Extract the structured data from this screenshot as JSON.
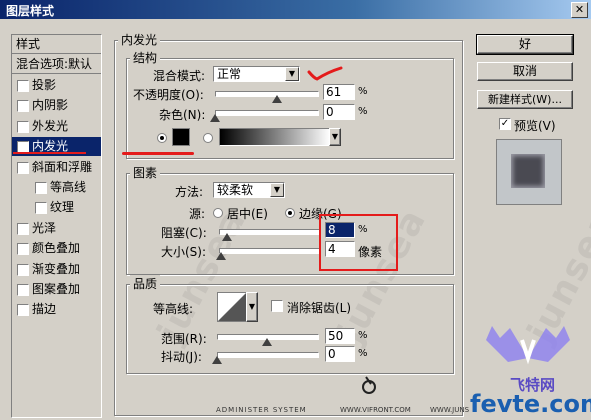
{
  "window": {
    "title": "图层样式",
    "close_glyph": "✕"
  },
  "style_list": {
    "header": "样式",
    "blend_options": "混合选项:默认",
    "items": [
      {
        "label": "投影",
        "checked": false
      },
      {
        "label": "内阴影",
        "checked": false
      },
      {
        "label": "外发光",
        "checked": false
      },
      {
        "label": "内发光",
        "checked": true,
        "selected": true
      },
      {
        "label": "斜面和浮雕",
        "checked": false
      },
      {
        "label": "等高线",
        "checked": false
      },
      {
        "label": "纹理",
        "checked": false
      },
      {
        "label": "光泽",
        "checked": false
      },
      {
        "label": "颜色叠加",
        "checked": false
      },
      {
        "label": "渐变叠加",
        "checked": false
      },
      {
        "label": "图案叠加",
        "checked": false
      },
      {
        "label": "描边",
        "checked": false
      }
    ]
  },
  "panel": {
    "title": "内发光",
    "structure": {
      "title": "结构",
      "blend_mode_label": "混合模式:",
      "blend_mode_value": "正常",
      "opacity_label": "不透明度(O):",
      "opacity_value": "61",
      "opacity_unit": "%",
      "noise_label": "杂色(N):",
      "noise_value": "0",
      "noise_unit": "%"
    },
    "elements": {
      "title": "图素",
      "method_label": "方法:",
      "method_value": "较柔软",
      "source_label": "源:",
      "source_center": "居中(E)",
      "source_edge": "边缘(G)",
      "choke_label": "阻塞(C):",
      "choke_value": "8",
      "choke_unit": "%",
      "size_label": "大小(S):",
      "size_value": "4",
      "size_unit": "像素"
    },
    "quality": {
      "title": "品质",
      "contour_label": "等高线:",
      "antialias_label": "消除锯齿(L)",
      "range_label": "范围(R):",
      "range_value": "50",
      "range_unit": "%",
      "jitter_label": "抖动(J):",
      "jitter_value": "0",
      "jitter_unit": "%"
    }
  },
  "buttons": {
    "ok": "好",
    "cancel": "取消",
    "new_style": "新建样式(W)...",
    "preview_label": "预览(V)",
    "preview_checked": true
  },
  "levels": {
    "opacity": 0.61,
    "noise": 0,
    "choke": 0.08,
    "size": 0.02,
    "range": 0.5,
    "jitter": 0
  },
  "watermark": {
    "text": "junsea",
    "footer_left": "ADMINISTER SYSTEM",
    "footer_mid": "WWW.VIFRONT.COM",
    "footer_right": "WWW.JUNS",
    "logo_cn": "飞特网",
    "logo_en": "fevte.com"
  },
  "colors": {
    "annotation_red": "#e41b1b",
    "selection": "#0a246a",
    "face": "#d4d0c8"
  },
  "icons": [
    "close-icon",
    "checkbox-icon",
    "dropdown-arrow-icon",
    "slider-thumb-icon",
    "radio-icon",
    "color-swatch",
    "gradient-swatch",
    "contour-icon",
    "preview-thumbnail",
    "logo-icon"
  ]
}
